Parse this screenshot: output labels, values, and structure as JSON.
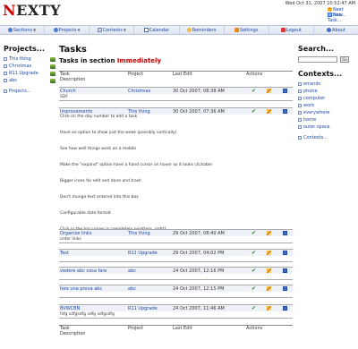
{
  "header": {
    "logo": "NEXTY",
    "datetime": "Wed Oct 31, 2007 10:52:47 AM",
    "next_action_link": "Next Action...",
    "new_task_link": "New Task..."
  },
  "nav": {
    "items": [
      {
        "label": "Sections",
        "icon": "sections-icon",
        "dropdown": true
      },
      {
        "label": "Projects",
        "icon": "projects-icon",
        "dropdown": true
      },
      {
        "label": "Contexts",
        "icon": "contexts-icon",
        "dropdown": true
      },
      {
        "label": "Calendar",
        "icon": "calendar-icon",
        "dropdown": false
      },
      {
        "label": "Reminders",
        "icon": "reminders-icon",
        "dropdown": false
      },
      {
        "label": "Settings",
        "icon": "settings-icon",
        "dropdown": false
      },
      {
        "label": "Logout",
        "icon": "logout-icon",
        "dropdown": false
      },
      {
        "label": "About",
        "icon": "about-icon",
        "dropdown": false
      }
    ]
  },
  "projects": {
    "title": "Projects...",
    "items": [
      "This thing",
      "Christmas",
      "R11 Upgrade",
      "abc"
    ],
    "more_link": "Projects..."
  },
  "main": {
    "title": "Tasks",
    "section_prefix": "Tasks in section",
    "section_name": "Immediately",
    "columns": {
      "task": "Task",
      "description": "Description",
      "project": "Project",
      "last_edit": "Last Edit",
      "actions": "Actions"
    },
    "tasks": [
      {
        "task": "Church",
        "project": "Christmas",
        "last_edit": "30 Oct 2007, 08:38 AM",
        "description": [
          "SDF"
        ]
      },
      {
        "task": "Improvements",
        "project": "This thing",
        "last_edit": "30 Oct 2007, 07:36 AM",
        "description": [
          "Click on the day number to add a task",
          "Have an option to show just the week (possibly vertically)",
          "See how well things work on a mobile",
          "Make the \"expand\" option have a hand cursor on hover so it looks clickable",
          "Bigger icons for edit and done and trash",
          "Don't munge text entered into this box",
          "Configurable date format",
          "Click in the top corner is completely pointless, right?"
        ]
      },
      {
        "task": "Organize links",
        "project": "This thing",
        "last_edit": "29 Oct 2007, 08:40 AM",
        "description": [
          "order links"
        ]
      },
      {
        "task": "Test",
        "project": "R11 Upgrade",
        "last_edit": "29 Oct 2007, 04:02 PM",
        "description": []
      },
      {
        "task": "vedere abc cosa fare",
        "project": "abc",
        "last_edit": "24 Oct 2007, 12:16 PM",
        "description": []
      },
      {
        "task": "fare una prova abc",
        "project": "abc",
        "last_edit": "24 Oct 2007, 12:15 PM",
        "description": []
      },
      {
        "task": "BVWCBN",
        "project": "R11 Upgrade",
        "last_edit": "24 Oct 2007, 11:46 AM",
        "description": [
          "fsfg sdfgsdfg sdfg sdfgsdfg"
        ]
      }
    ]
  },
  "search": {
    "title": "Search...",
    "button": "Go"
  },
  "contexts": {
    "title": "Contexts...",
    "items": [
      "errands",
      "phone",
      "computer",
      "work",
      "everywhere",
      "home",
      "outer space"
    ],
    "more_link": "Contexts..."
  },
  "colors": {
    "accent": "#1a47a8",
    "section_highlight": "#cc0000",
    "row_bg": "#eef1f7",
    "done": "#2e8b2e"
  }
}
